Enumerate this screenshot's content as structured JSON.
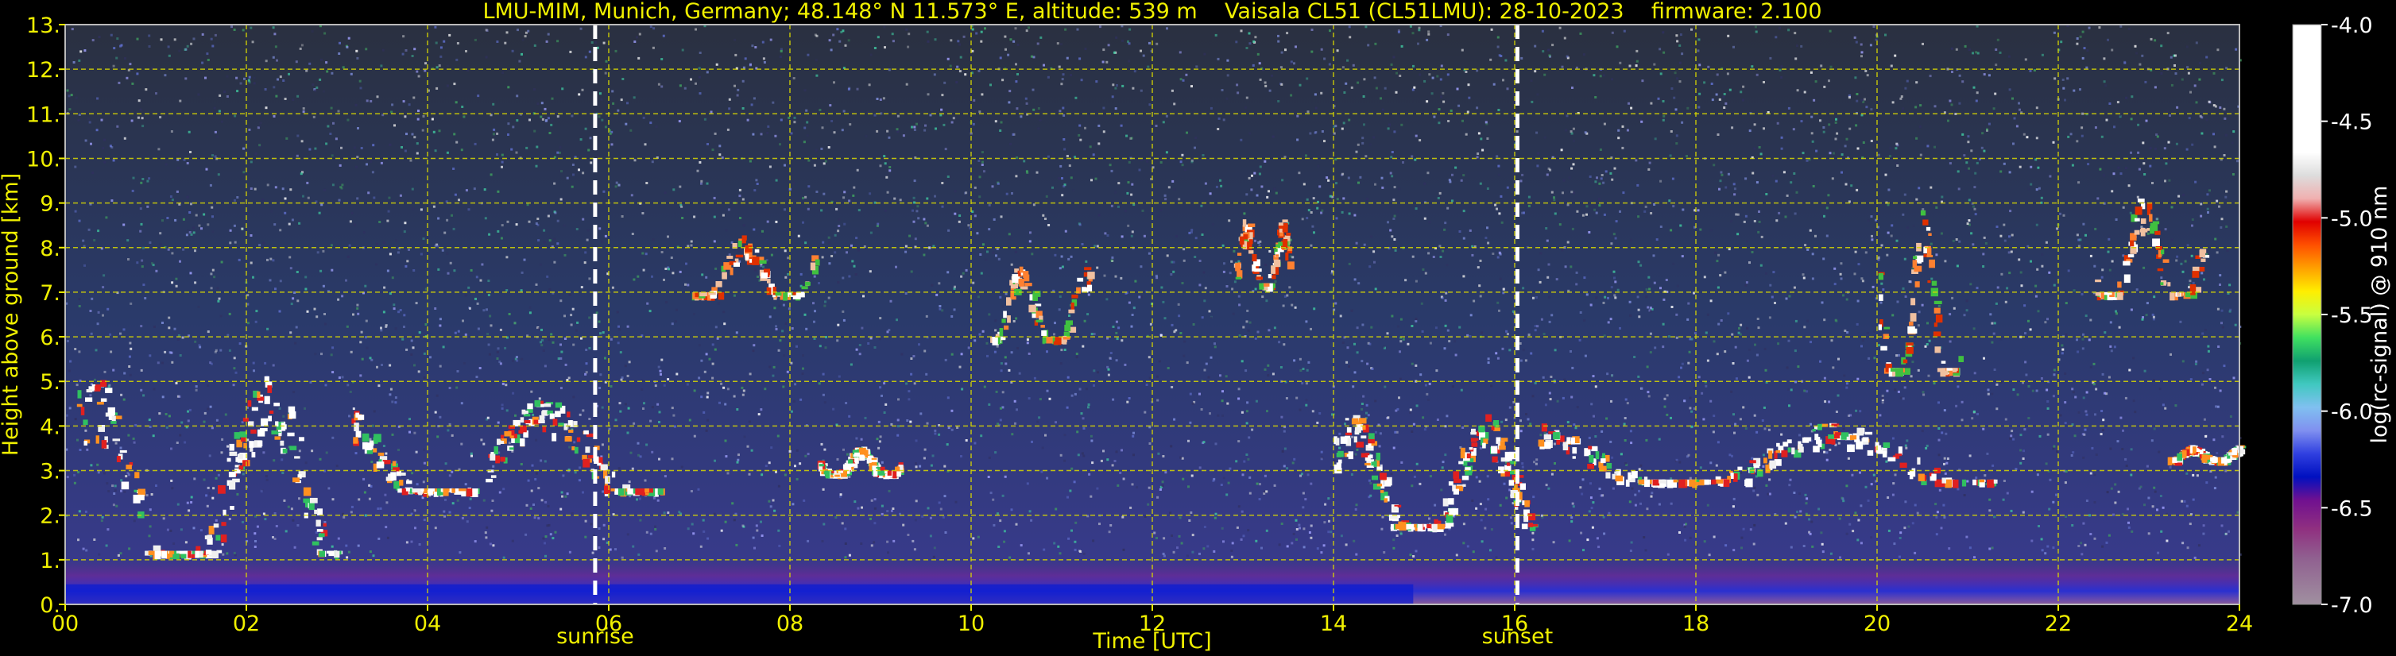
{
  "title": "LMU-MIM, Munich, Germany; 48.148° N 11.573° E, altitude: 539 m    Vaisala CL51 (CL51LMU): 28-10-2023    firmware: 2.100",
  "colors": {
    "text": "#f0f000",
    "grid": "#d8d800",
    "marker": "#ffffff",
    "background": "#000000"
  },
  "chart_data": {
    "type": "heatmap",
    "xlabel": "Time [UTC]",
    "ylabel": "Height above ground [km]",
    "xlim": [
      0,
      24
    ],
    "ylim": [
      0,
      13
    ],
    "xticks": [
      "00",
      "02",
      "04",
      "06",
      "08",
      "10",
      "12",
      "14",
      "16",
      "18",
      "20",
      "22",
      "24"
    ],
    "xtick_values": [
      0,
      2,
      4,
      6,
      8,
      10,
      12,
      14,
      16,
      18,
      20,
      22,
      24
    ],
    "yticks": [
      "0.",
      "1.",
      "2.",
      "3.",
      "4.",
      "5.",
      "6.",
      "7.",
      "8.",
      "9.",
      "10.",
      "11.",
      "12.",
      "13."
    ],
    "ytick_values": [
      0,
      1,
      2,
      3,
      4,
      5,
      6,
      7,
      8,
      9,
      10,
      11,
      12,
      13
    ],
    "grid": true,
    "events": [
      {
        "label": "sunrise",
        "time": 5.85
      },
      {
        "label": "sunset",
        "time": 16.03
      }
    ],
    "colorbar": {
      "label": "log(rc-signal) @ 910 nm",
      "ticks": [
        "-4.0",
        "-4.5",
        "-5.0",
        "-5.5",
        "-6.0",
        "-6.5",
        "-7.0"
      ],
      "tick_values": [
        -4.0,
        -4.5,
        -5.0,
        -5.5,
        -6.0,
        -6.5,
        -7.0
      ],
      "range": [
        -7.0,
        -4.0
      ]
    },
    "features": [
      {
        "kind": "boundary-layer-aerosol",
        "t_start": 0,
        "t_end": 24,
        "top_km": 1.0
      },
      {
        "kind": "cloud-layer",
        "t_start": 0.1,
        "t_end": 3.0,
        "base_km": 1.2,
        "top_km": 5.5
      },
      {
        "kind": "cloud-layer",
        "t_start": 3.1,
        "t_end": 6.6,
        "base_km": 2.6,
        "top_km": 4.8
      },
      {
        "kind": "cloud-layer",
        "t_start": 8.3,
        "t_end": 9.2,
        "base_km": 3.0,
        "top_km": 3.6
      },
      {
        "kind": "cirrus",
        "t_start": 6.9,
        "t_end": 8.3,
        "base_km": 7.0,
        "top_km": 8.4
      },
      {
        "kind": "cirrus",
        "t_start": 10.2,
        "t_end": 11.3,
        "base_km": 6.0,
        "top_km": 7.8
      },
      {
        "kind": "cirrus",
        "t_start": 12.9,
        "t_end": 13.5,
        "base_km": 7.2,
        "top_km": 8.8
      },
      {
        "kind": "cloud-layer",
        "t_start": 14.0,
        "t_end": 16.2,
        "base_km": 1.8,
        "top_km": 4.5
      },
      {
        "kind": "cloud-layer",
        "t_start": 16.2,
        "t_end": 21.3,
        "base_km": 2.8,
        "top_km": 4.2
      },
      {
        "kind": "cirrus",
        "t_start": 20.0,
        "t_end": 20.9,
        "base_km": 5.3,
        "top_km": 9.2
      },
      {
        "kind": "cirrus",
        "t_start": 22.4,
        "t_end": 23.6,
        "base_km": 7.0,
        "top_km": 9.5
      },
      {
        "kind": "cloud-layer",
        "t_start": 23.2,
        "t_end": 24.0,
        "base_km": 3.3,
        "top_km": 3.6
      }
    ]
  }
}
